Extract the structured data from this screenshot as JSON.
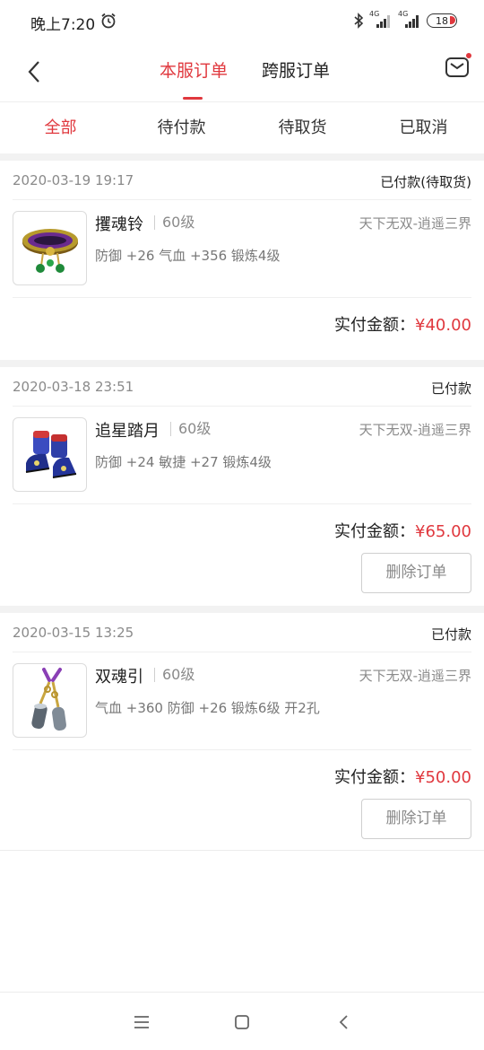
{
  "status_bar": {
    "time": "晚上7:20",
    "alarm_icon": "alarm-clock-icon",
    "bluetooth_icon": "bluetooth-icon",
    "signal_1_label": "4G",
    "signal_2_label": "4G",
    "battery": "18"
  },
  "header": {
    "tabs": [
      {
        "label": "本服订单",
        "active": true
      },
      {
        "label": "跨服订单",
        "active": false
      }
    ],
    "back_icon": "chevron-left-icon",
    "message_icon": "envelope-icon",
    "accent_color": "#e0383e"
  },
  "status_tabs": [
    {
      "label": "全部",
      "active": true
    },
    {
      "label": "待付款",
      "active": false
    },
    {
      "label": "待取货",
      "active": false
    },
    {
      "label": "已取消",
      "active": false
    }
  ],
  "orders": [
    {
      "time": "2020-03-19 19:17",
      "status": "已付款(待取货)",
      "item_name": "攫魂铃",
      "item_level": "60级",
      "server": "天下无双-逍遥三界",
      "attrs": "防御 +26 气血 +356 锻炼4级",
      "amount_label": "实付金额：",
      "amount_value": "¥40.00",
      "image_icon": "bracelet-icon"
    },
    {
      "time": "2020-03-18 23:51",
      "status": "已付款",
      "item_name": "追星踏月",
      "item_level": "60级",
      "server": "天下无双-逍遥三界",
      "attrs": "防御 +24 敏捷 +27 锻炼4级",
      "amount_label": "实付金额：",
      "amount_value": "¥65.00",
      "delete_label": "删除订单",
      "image_icon": "boots-icon"
    },
    {
      "time": "2020-03-15 13:25",
      "status": "已付款",
      "item_name": "双魂引",
      "item_level": "60级",
      "server": "天下无双-逍遥三界",
      "attrs": "气血 +360 防御 +26 锻炼6级 开2孔",
      "amount_label": "实付金额：",
      "amount_value": "¥50.00",
      "delete_label": "删除订单",
      "image_icon": "chain-pendant-icon"
    }
  ],
  "nav_bar": {
    "menu_icon": "menu-icon",
    "home_icon": "square-home-icon",
    "back_icon": "triangle-back-icon"
  }
}
